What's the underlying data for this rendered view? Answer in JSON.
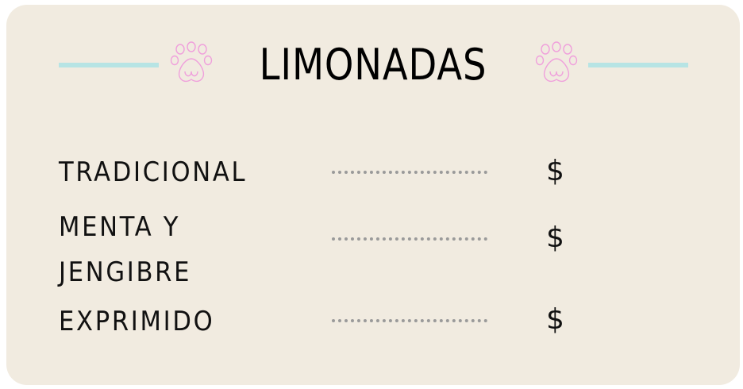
{
  "menu": {
    "title": "LIMONADAS",
    "items": [
      {
        "name": "TRADICIONAL",
        "price": "$"
      },
      {
        "name": "MENTA Y JENGIBRE",
        "price": "$"
      },
      {
        "name": "EXPRIMIDO",
        "price": "$"
      }
    ]
  },
  "decorations": {
    "left_icon": "paw-print-icon",
    "right_icon": "paw-print-icon",
    "rule_color": "#b7e4e4",
    "paw_color": "#f0a0dc"
  },
  "colors": {
    "background": "#f1ebe0",
    "text": "#111111",
    "dots": "#9a9a9a"
  }
}
